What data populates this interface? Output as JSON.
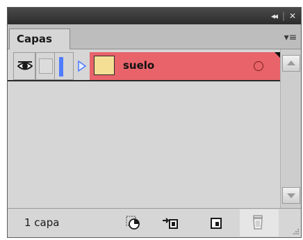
{
  "titlebar": {
    "collapse_glyph": "◂◂",
    "separator_glyph": "|",
    "close_glyph": "✕"
  },
  "tabs": [
    {
      "label": "Capas"
    }
  ],
  "panel_menu_glyph": "▾≡",
  "layers": [
    {
      "name": "suelo",
      "visible": true,
      "locked": false,
      "layer_color": "#4f7cff",
      "row_color": "#e8636a",
      "thumbnail_color": "#f4df95"
    }
  ],
  "footer": {
    "layer_count": "1 capa"
  },
  "icons": {
    "eye": "eye-icon",
    "expand": "expand-triangle-icon",
    "target": "target-circle-icon",
    "clip": "clipping-mask-icon",
    "sublayer": "new-sublayer-icon",
    "newlayer": "new-layer-icon",
    "trash": "trash-icon"
  }
}
